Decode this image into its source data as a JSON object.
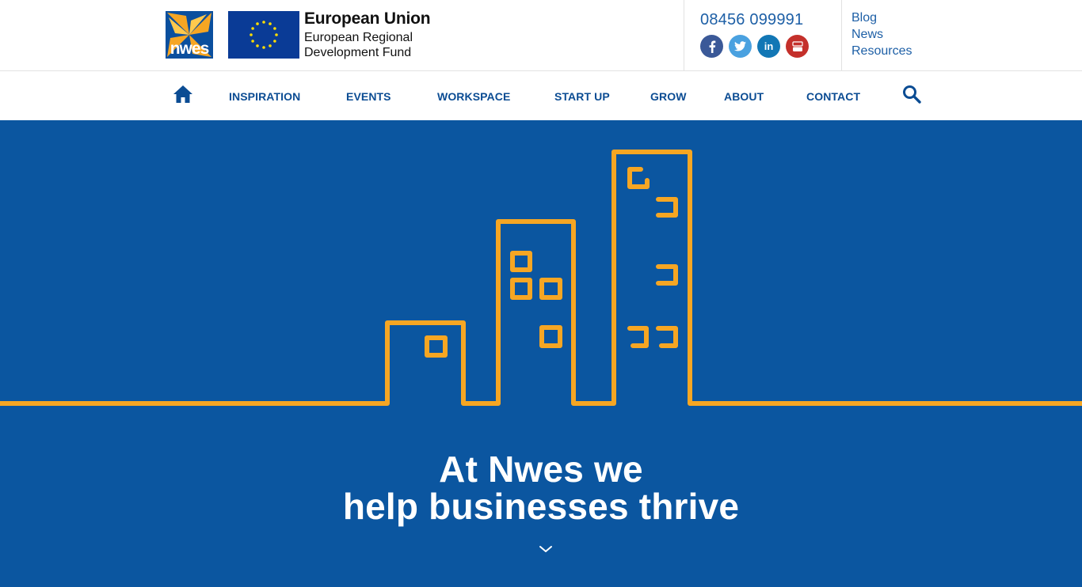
{
  "header": {
    "logo_text": "nwes",
    "eu": {
      "title": "European Union",
      "subtitle_line1": "European Regional",
      "subtitle_line2": "Development Fund"
    },
    "phone": "08456 099991",
    "social_icons": [
      "facebook-icon",
      "twitter-icon",
      "linkedin-icon",
      "youtube-icon"
    ],
    "top_links": [
      "Blog",
      "News",
      "Resources"
    ]
  },
  "nav": {
    "items": [
      "INSPIRATION",
      "EVENTS",
      "WORKSPACE",
      "START UP",
      "GROW",
      "ABOUT",
      "CONTACT"
    ],
    "home_icon": "home-icon",
    "search_icon": "search-icon"
  },
  "hero": {
    "title_line1": "At Nwes we",
    "title_line2": "help businesses thrive",
    "scroll_icon": "chevron-down-icon"
  },
  "colors": {
    "brand_blue": "#0b56a0",
    "nav_blue": "#0b4c93",
    "accent_orange": "#f6a623",
    "link_blue": "#1d5fa6"
  }
}
